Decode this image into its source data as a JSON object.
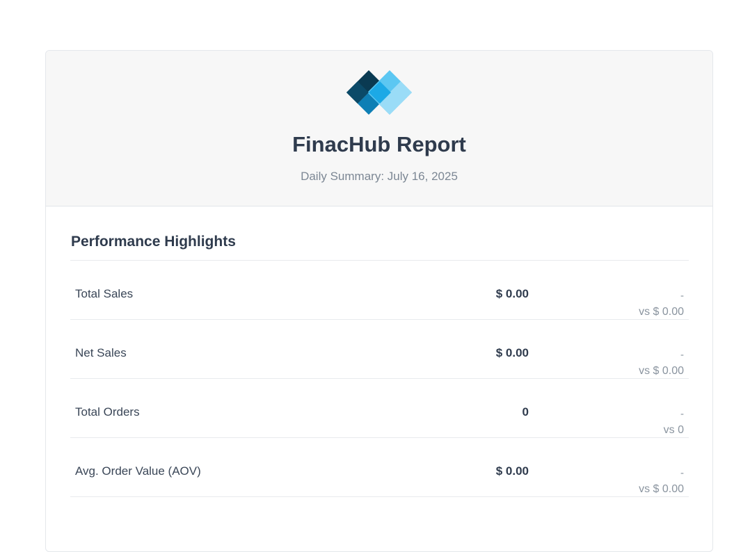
{
  "header": {
    "title": "FinacHub Report",
    "subtitle": "Daily Summary: July 16, 2025",
    "logo_icon": "diamond-logo-icon",
    "logo_colors": [
      "#0a3a52",
      "#0e7fb5",
      "#1ca9e6",
      "#5cc7f2",
      "#9adcf7"
    ]
  },
  "section": {
    "title": "Performance Highlights"
  },
  "metrics": [
    {
      "label": "Total Sales",
      "value": "$ 0.00",
      "change": "-",
      "compare": "vs $ 0.00"
    },
    {
      "label": "Net Sales",
      "value": "$ 0.00",
      "change": "-",
      "compare": "vs $ 0.00"
    },
    {
      "label": "Total Orders",
      "value": "0",
      "change": "-",
      "compare": "vs 0"
    },
    {
      "label": "Avg. Order Value (AOV)",
      "value": "$ 0.00",
      "change": "-",
      "compare": "vs $ 0.00"
    }
  ]
}
